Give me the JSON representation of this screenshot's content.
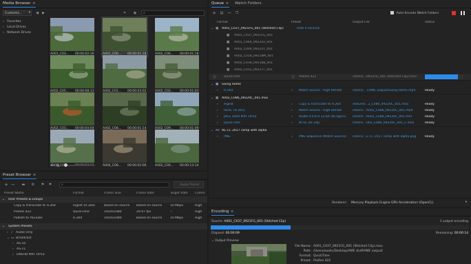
{
  "media_browser": {
    "title": "Media Browser",
    "workspace": "Customiz...",
    "favorites": "Favorites",
    "local_drives": "Local Drives",
    "network_drives": "Network Drives",
    "thumbnails": [
      {
        "name": "A001_C03...",
        "duration": "00:00:02:16"
      },
      {
        "name": "A001_C06...",
        "duration": "00:00:01:18"
      },
      {
        "name": "A002_C06...",
        "duration": "00:00:01:18"
      },
      {
        "name": "A002_C05...",
        "duration": "00:00:08:13"
      },
      {
        "name": "A002_C01...",
        "duration": "00:00:03:02"
      },
      {
        "name": "A002_C02...",
        "duration": "00:00:01:03"
      },
      {
        "name": "A002_C03...",
        "duration": "00:00:04:04"
      },
      {
        "name": "A002_C08...",
        "duration": "00:00:01:14"
      },
      {
        "name": "A002_C09...",
        "duration": "00:00:01:09"
      },
      {
        "name": "A003_C00...",
        "duration": "00:00:03:12"
      },
      {
        "name": "A004_C08...",
        "duration": "00:00:02:06"
      },
      {
        "name": "A002_C00...",
        "duration": "00:00:13:14"
      }
    ]
  },
  "preset_browser": {
    "title": "Preset Browser",
    "apply_preset": "Apply Preset",
    "columns": {
      "name": "Preset Name",
      "format": "Format",
      "frame_size": "Frame Size",
      "frame_rate": "Frame Rate",
      "target_rate": "Target Rate",
      "comment": "Comm"
    },
    "groups": [
      {
        "label": "User Presets & Groups",
        "rows": [
          {
            "name": "Copy & transcode to H.264",
            "format": "Ingest (H.264)",
            "frame_size": "Based on source",
            "frame_rate": "Based on source",
            "target_rate": "10 Mbps",
            "comment": "High"
          },
          {
            "name": "ProRes 422",
            "format": "QuickTime",
            "frame_size": "1920x1080",
            "frame_rate": "29.97 fps",
            "target_rate": "--",
            "comment": "High"
          },
          {
            "name": "Publish to YouTube",
            "format": "H.264",
            "frame_size": "1920x1080",
            "frame_rate": "Based on source",
            "target_rate": "10 Mbps",
            "comment": "High"
          }
        ]
      }
    ],
    "system_presets": "System Presets",
    "sys_items": [
      "Audio Only",
      "Broadcast",
      "AS-10",
      "AS-11",
      "DNxHD MXF OP1a"
    ]
  },
  "queue": {
    "tab_queue": "Queue",
    "tab_watch": "Watch Folders",
    "auto_encode": "Auto-Encode Watch Folders",
    "columns": {
      "format": "Format",
      "preset": "Preset",
      "output": "Output File",
      "status": "Status"
    },
    "stitched": {
      "name": "A001_C037_0921FG_001 (Stitched Clip)",
      "hide_sources": "Hide 6 sources",
      "sources": [
        "A001_C037_0921FG_001",
        "A001_C064_092242_001",
        "A002_C009_092221_001",
        "A002_C018_09218M_001",
        "A002_C038_09218B_001",
        "A002_C052_09227T_001"
      ],
      "format": "QuickTime",
      "preset": "ProRes 422",
      "output": "/Users/...0921FG_001 (Stitched Clip).mov",
      "progress": 0.85
    },
    "group2": {
      "name": "Going Home",
      "format": "H.264",
      "preset": "Match Source - High Bitrate",
      "output": "/Users/...T/AME output/Going Home.mp4",
      "status": "Ready"
    },
    "group3": {
      "name": "A002_C086_09220C_001.mov",
      "rows": [
        {
          "format": "Ingest",
          "preset": "Copy & transcode to H.264",
          "output": "/Volume...2_C086_09220C_001.mov",
          "status": "Ready"
        },
        {
          "format": "HEVC (H.265)",
          "preset": "Match Source - High Bitrate",
          "output": "/Users/...A002_C086_09220C_001.mp4",
          "status": "Ready"
        },
        {
          "format": "JPEG 2000 MXF OP1a",
          "preset": "RGBA 4:4:4:4 12-bit (BCS@L5)",
          "output": "/Users/...A002_C086_09220C_001.mxf",
          "status": "Ready"
        },
        {
          "format": "QuickTime",
          "preset": "NTSC DV 24p",
          "output": "/Users/...002_C086_09220C_001_1.mov",
          "status": "Ready"
        }
      ]
    },
    "group4": {
      "name": "AE CC 2017 comp with alpha",
      "format": "PNG",
      "preset": "PNG Sequence (Match Source)",
      "output": "/Users/...E CC 2017 comp with alpha.png",
      "status": "Ready"
    },
    "renderer_label": "Renderer:",
    "renderer_value": "Mercury Playback Engine GPU Acceleration (OpenCL)"
  },
  "encoding": {
    "title": "Encoding",
    "source_label": "Source:",
    "source_value": "A001_C037_0921FG_001 (Stitched Clip)",
    "outputs_count": "1 output encoding",
    "progress": 0.31,
    "elapsed_label": "Elapsed:",
    "elapsed_value": "00:00:09",
    "remaining_label": "Remaining:",
    "remaining_value": "00:00:14",
    "output_preview": "Output Preview",
    "file_name_label": "File Name:",
    "file_name_value": "A001_C037_0921FG_001 (Stitched Clip).mov",
    "path_label": "Path:",
    "path_value": "/Users/oooliv/Desktop/AME stuff/AME output/",
    "format_label": "Format:",
    "format_value": "QuickTime",
    "preset_label": "Preset:",
    "preset_value": "ProRes 422"
  },
  "colors": {
    "accent": "#2d8ceb",
    "panel": "#232323",
    "background": "#1d1d1d"
  }
}
